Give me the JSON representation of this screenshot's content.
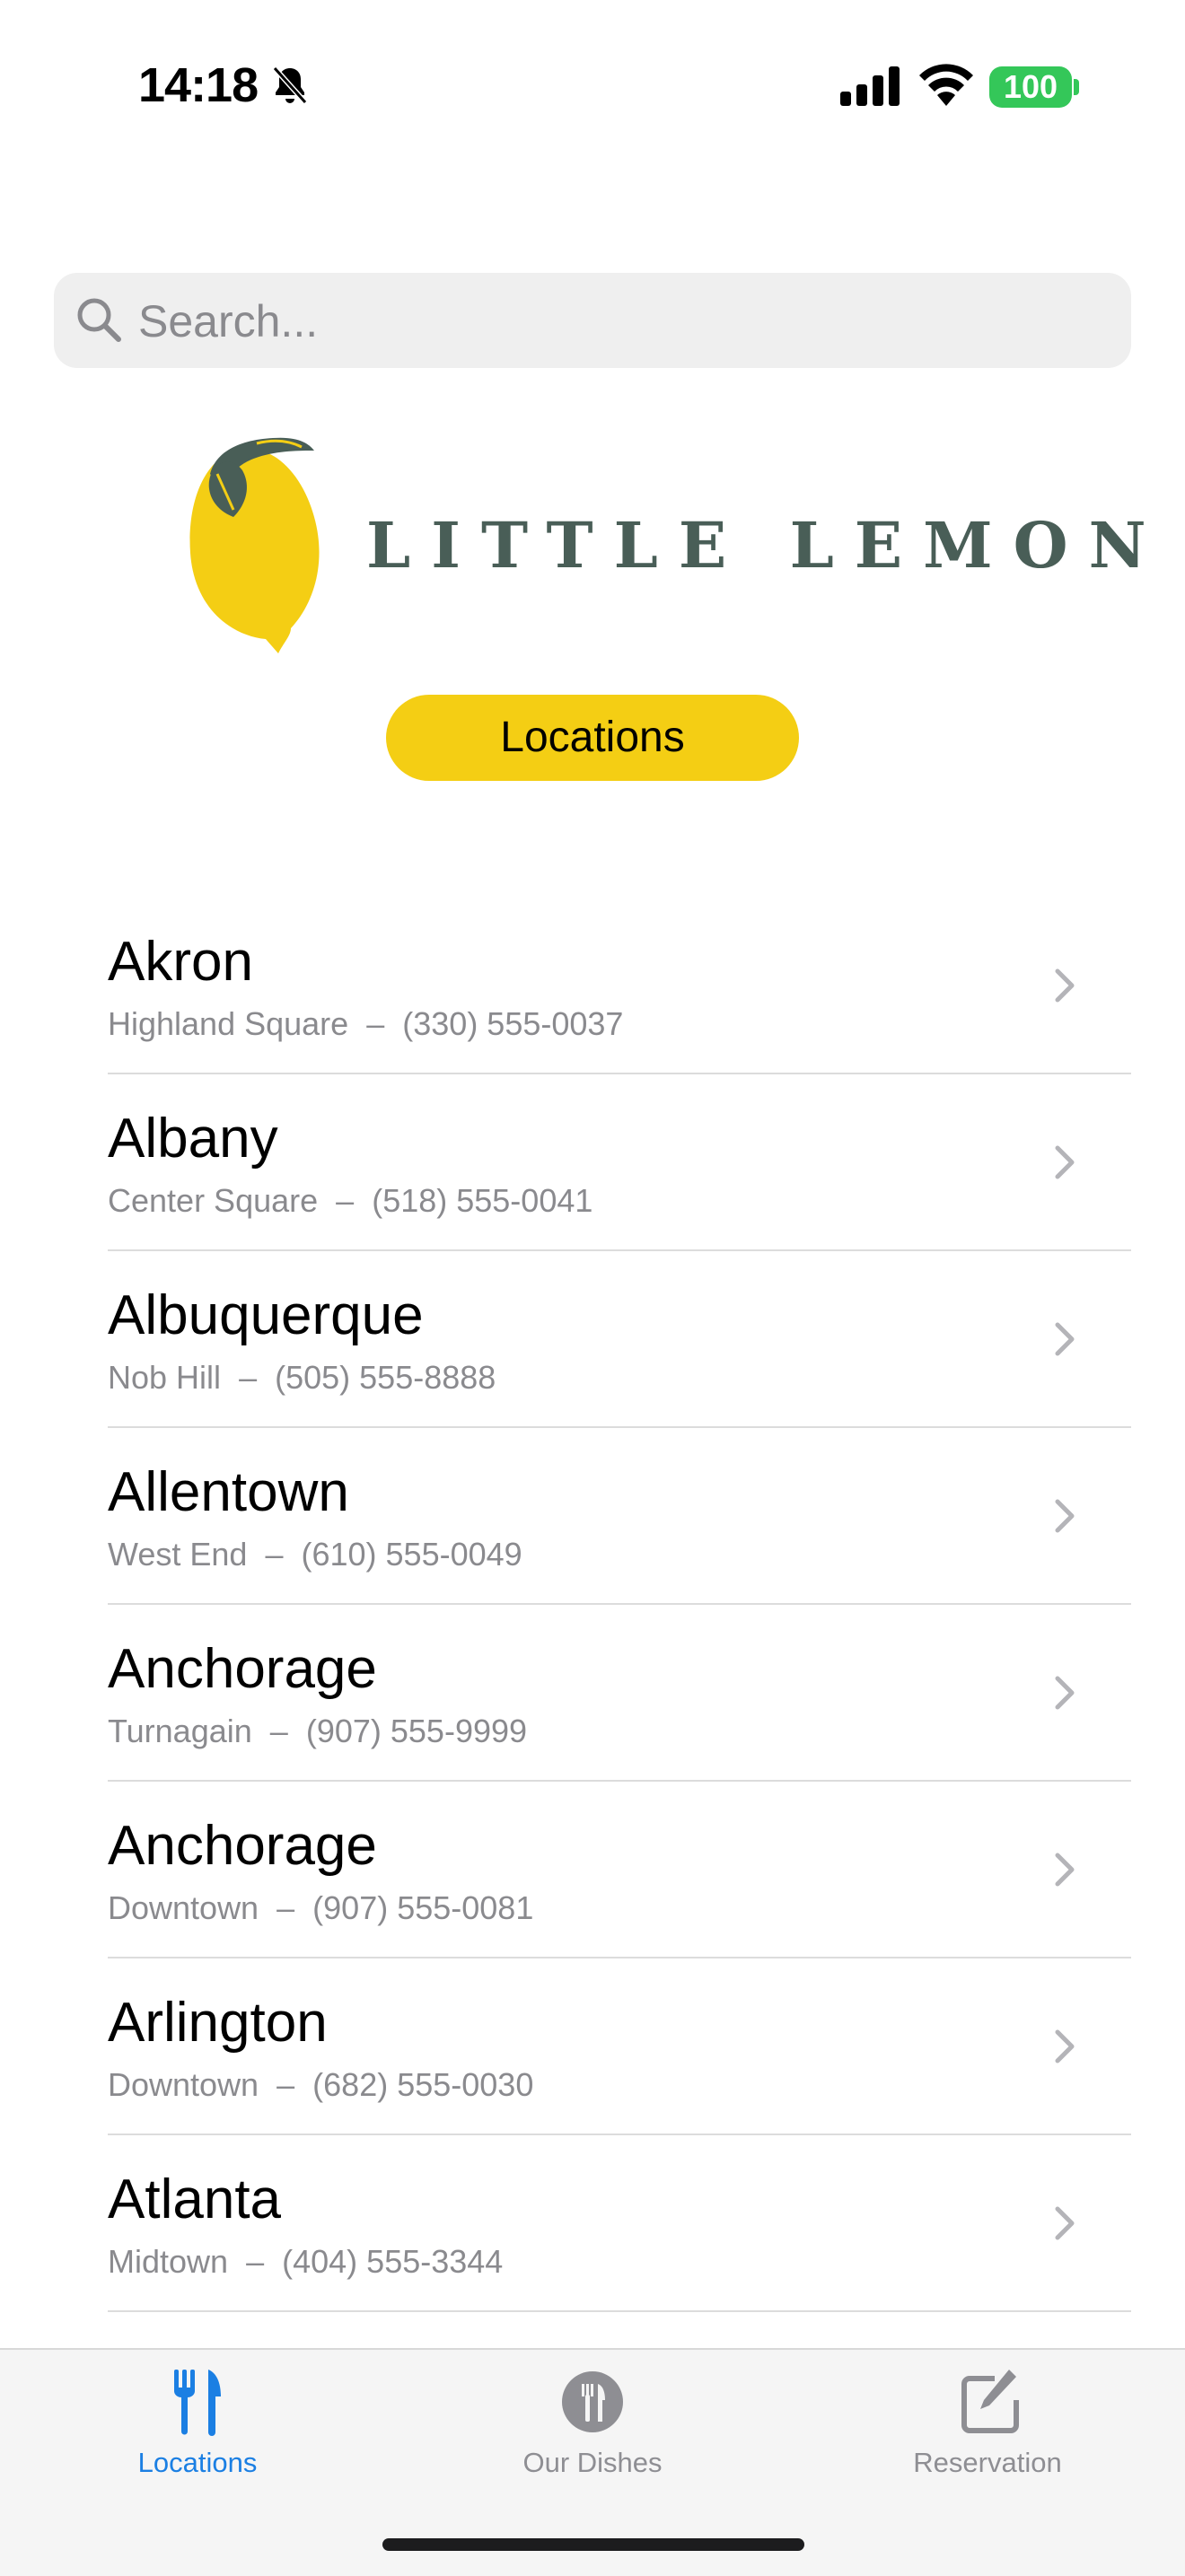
{
  "status_bar": {
    "time": "14:18",
    "battery": "100"
  },
  "search": {
    "placeholder": "Search..."
  },
  "brand": {
    "name": "LITTLE LEMON"
  },
  "header": {
    "button_label": "Locations"
  },
  "locations": [
    {
      "city": "Akron",
      "neighborhood": "Highland Square",
      "separator": "–",
      "phone": "(330) 555-0037"
    },
    {
      "city": "Albany",
      "neighborhood": "Center Square",
      "separator": "–",
      "phone": "(518) 555-0041"
    },
    {
      "city": "Albuquerque",
      "neighborhood": "Nob Hill",
      "separator": "–",
      "phone": "(505) 555-8888"
    },
    {
      "city": "Allentown",
      "neighborhood": "West End",
      "separator": "–",
      "phone": "(610) 555-0049"
    },
    {
      "city": "Anchorage",
      "neighborhood": "Turnagain",
      "separator": "–",
      "phone": "(907) 555-9999"
    },
    {
      "city": "Anchorage",
      "neighborhood": "Downtown",
      "separator": "–",
      "phone": "(907) 555-0081"
    },
    {
      "city": "Arlington",
      "neighborhood": "Downtown",
      "separator": "–",
      "phone": "(682) 555-0030"
    },
    {
      "city": "Atlanta",
      "neighborhood": "Midtown",
      "separator": "–",
      "phone": "(404) 555-3344"
    }
  ],
  "tab_bar": {
    "tabs": [
      {
        "label": "Locations",
        "icon": "fork-knife-icon",
        "active": true
      },
      {
        "label": "Our Dishes",
        "icon": "dishes-icon",
        "active": false
      },
      {
        "label": "Reservation",
        "icon": "square-pencil-icon",
        "active": false
      }
    ]
  },
  "colors": {
    "brand_yellow": "#f4ce14",
    "brand_green": "#495e57",
    "tab_active": "#1b7fe3",
    "tab_inactive": "#8e8e93",
    "battery": "#34c759"
  }
}
